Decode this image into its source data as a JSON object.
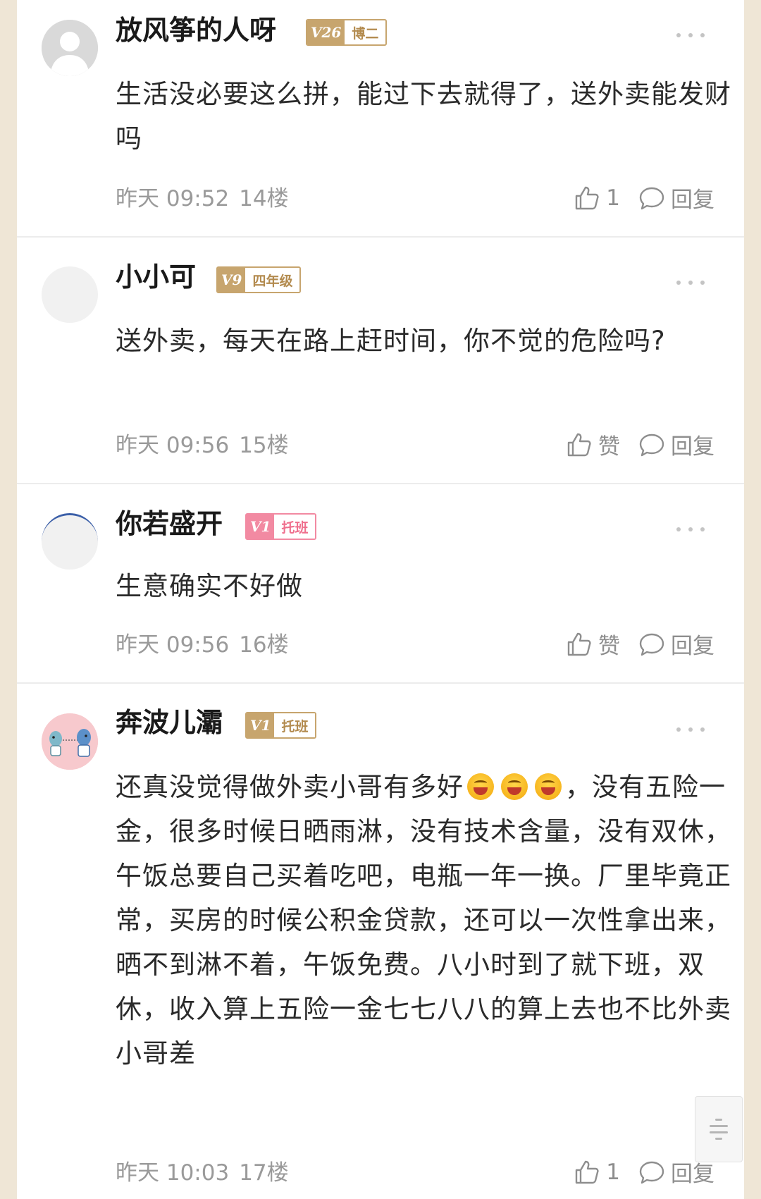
{
  "comments": [
    {
      "username": "放风筝的人呀",
      "level": "V26",
      "title": "博二",
      "badge_color": "gold",
      "avatar": "default-avatar",
      "text": "生活没必要这么拼，能过下去就得了，送外卖能发财吗",
      "time": "昨天 09:52",
      "floor": "14楼",
      "like_label": "1",
      "reply_label": "回复"
    },
    {
      "username": "小小可",
      "level": "V9",
      "title": "四年级",
      "badge_color": "gold",
      "avatar": "blank-avatar",
      "text": "送外卖，每天在路上赶时间，你不觉的危险吗?",
      "time": "昨天 09:56",
      "floor": "15楼",
      "like_label": "赞",
      "reply_label": "回复"
    },
    {
      "username": "你若盛开",
      "level": "V1",
      "title": "托班",
      "badge_color": "pink",
      "avatar": "blank-avatar",
      "text": "生意确实不好做",
      "time": "昨天 09:56",
      "floor": "16楼",
      "like_label": "赞",
      "reply_label": "回复"
    },
    {
      "username": "奔波儿灞",
      "level": "V1",
      "title": "托班",
      "badge_color": "gold",
      "avatar": "cartoon-avatar",
      "text_before_emoji": "还真没觉得做外卖小哥有多好",
      "emoji_name": "laughing-emoji",
      "text_after_emoji": "，没有五险一金，很多时候日晒雨淋，没有技术含量，没有双休，午饭总要自己买着吃吧，电瓶一年一换。厂里毕竟正常，买房的时候公积金贷款，还可以一次性拿出来，晒不到淋不着，午饭免费。八小时到了就下班，双休，收入算上五险一金七七八八的算上去也不比外卖小哥差",
      "time": "昨天 10:03",
      "floor": "17楼",
      "like_label": "1",
      "reply_label": "回复"
    }
  ],
  "icons": {
    "like": "thumbs-up-icon",
    "reply": "speech-bubble-icon",
    "more": "more-dots-icon",
    "scroll": "scroll-handle-icon"
  },
  "colors": {
    "page_background": "#efe6d6",
    "badge_gold": "#c7a56e",
    "badge_pink": "#f28aa2",
    "meta_gray": "#9a9a9a"
  }
}
